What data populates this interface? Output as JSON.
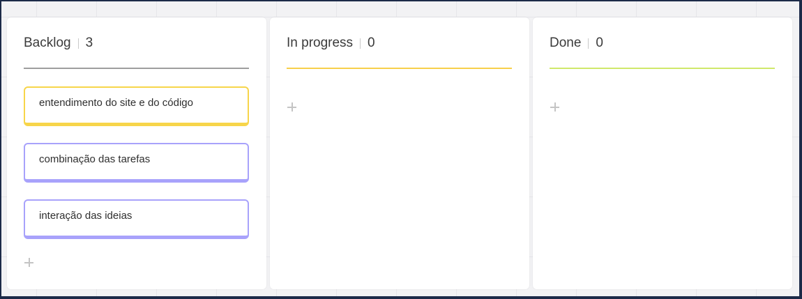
{
  "board": {
    "columns": [
      {
        "title": "Backlog",
        "count": "3",
        "accent": "#9e9e9e",
        "cards": [
          {
            "text": "entendimento do site e do código",
            "color": "#f7d54a"
          },
          {
            "text": "combinação das tarefas",
            "color": "#a8a2fb"
          },
          {
            "text": "interação das ideias",
            "color": "#a8a2fb"
          }
        ],
        "add_icon": "plus-icon"
      },
      {
        "title": "In progress",
        "count": "0",
        "accent": "#f7cf4a",
        "cards": [],
        "add_icon": "plus-icon"
      },
      {
        "title": "Done",
        "count": "0",
        "accent": "#cfe86a",
        "cards": [],
        "add_icon": "plus-icon"
      }
    ]
  }
}
